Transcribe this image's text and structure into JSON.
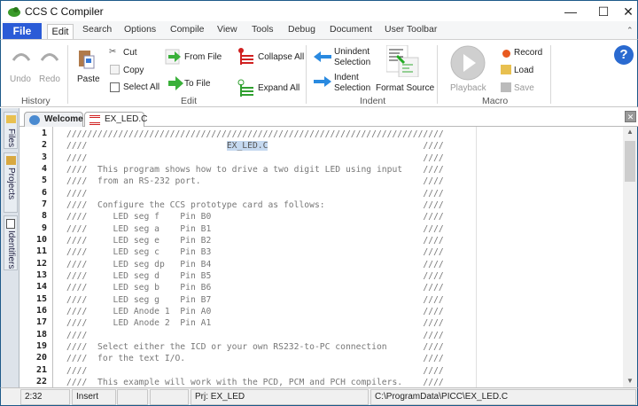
{
  "window": {
    "title": "CCS C Compiler",
    "minimize": "—",
    "maximize": "☐",
    "close": "✕"
  },
  "menu": {
    "file": "File",
    "tabs": [
      "Edit",
      "Search",
      "Options",
      "Compile",
      "View",
      "Tools",
      "Debug",
      "Document",
      "User Toolbar"
    ]
  },
  "ribbon": {
    "history": {
      "label": "History",
      "undo": "Undo",
      "redo": "Redo"
    },
    "edit": {
      "label": "Edit",
      "paste": "Paste",
      "cut": "Cut",
      "copy": "Copy",
      "select_all": "Select All",
      "from_file": "From File",
      "to_file": "To File",
      "collapse_all": "Collapse All",
      "expand_all": "Expand All"
    },
    "indent": {
      "label": "Indent",
      "unindent": "Unindent Selection",
      "indent": "Indent Selection",
      "format_source": "Format Source"
    },
    "macro": {
      "label": "Macro",
      "playback": "Playback",
      "record": "Record",
      "load": "Load",
      "save": "Save"
    }
  },
  "sidebar": {
    "tabs": [
      "Files",
      "Projects",
      "Identifiers"
    ]
  },
  "doc_tabs": [
    {
      "label": "Welcome"
    },
    {
      "label": "EX_LED.C",
      "active": true
    }
  ],
  "editor": {
    "selected_text": "EX_LED.C",
    "line_suffix": "////",
    "lines": [
      "/////////////////////////////////////////////////////////////////////////",
      "////                           EX_LED.C",
      "////",
      "////  This program shows how to drive a two digit LED using input",
      "////  from an RS-232 port.",
      "////",
      "////  Configure the CCS prototype card as follows:",
      "////     LED seg f    Pin B0",
      "////     LED seg a    Pin B1",
      "////     LED seg e    Pin B2",
      "////     LED seg c    Pin B3",
      "////     LED seg dp   Pin B4",
      "////     LED seg d    Pin B5",
      "////     LED seg b    Pin B6",
      "////     LED seg g    Pin B7",
      "////     LED Anode 1  Pin A0",
      "////     LED Anode 2  Pin A1",
      "////",
      "////  Select either the ICD or your own RS232-to-PC connection",
      "////  for the text I/O.",
      "////",
      "////  This example will work with the PCD, PCM and PCH compilers."
    ]
  },
  "status": {
    "position": "2:32",
    "mode": "Insert",
    "seg3": "",
    "seg4": "",
    "project": "Prj: EX_LED",
    "path": "C:\\ProgramData\\PICC\\EX_LED.C"
  },
  "colors": {
    "file_tab": "#2a5bd7",
    "selection": "#c5d9f0",
    "window_border": "#1e5a8a"
  }
}
